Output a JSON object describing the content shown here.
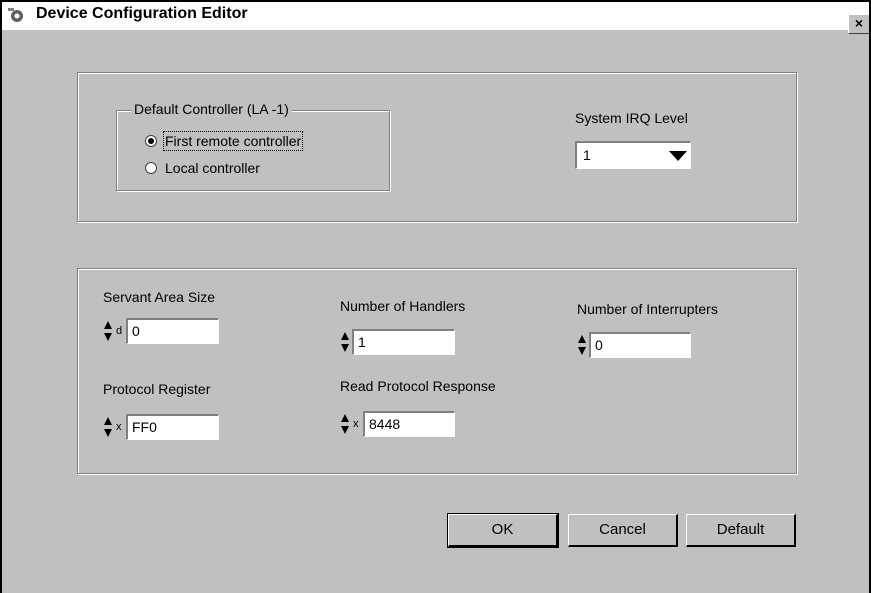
{
  "window": {
    "title": "Device Configuration Editor",
    "close_glyph": "×"
  },
  "controller_group": {
    "legend": "Default Controller (LA -1)",
    "options": [
      {
        "label": "First remote controller",
        "selected": true
      },
      {
        "label": "Local controller",
        "selected": false
      }
    ]
  },
  "irq": {
    "label": "System IRQ Level",
    "value": "1"
  },
  "fields": {
    "servant_area_size": {
      "label": "Servant Area Size",
      "prefix": "d",
      "value": "0"
    },
    "number_of_handlers": {
      "label": "Number of Handlers",
      "prefix": "",
      "value": "1"
    },
    "number_of_interrupters": {
      "label": "Number of Interrupters",
      "prefix": "",
      "value": "0"
    },
    "protocol_register": {
      "label": "Protocol Register",
      "prefix": "x",
      "value": "FF0"
    },
    "read_protocol_response": {
      "label": "Read Protocol Response",
      "prefix": "x",
      "value": "8448"
    }
  },
  "buttons": {
    "ok": "OK",
    "cancel": "Cancel",
    "default": "Default"
  },
  "icons": {
    "app": "gear-icon",
    "spinner": "spinner-arrows-icon",
    "dropdown": "dropdown-arrow-icon"
  }
}
